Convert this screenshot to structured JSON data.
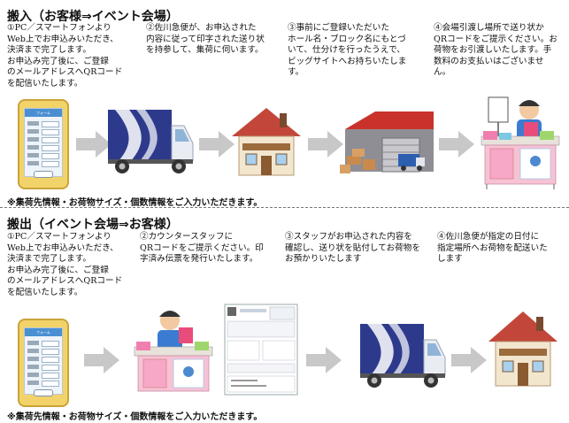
{
  "section_in": {
    "title": "搬入（お客様⇒イベント会場）",
    "steps": [
      "①PC／スマートフォンより\nWeb上でお申込みいただき、\n決済まで完了します。\nお申込み完了後に、ご登録\nのメールアドレスへQRコード\nを配信いたします。",
      "②佐川急便が、お申込された\n内容に従って印字された送り状\nを持参して、集荷に伺います。",
      "③事前にご登録いただいた\nホール名・ブロック名にもとづ\nいて、仕分けを行ったうえで、\nビッグサイトへお持ちいたしま\nす。",
      "④会場引渡し場所で送り状か\nQRコードをご提示ください。お\n荷物をお引渡しいたします。手\n数料のお支払いはございませ\nん。"
    ],
    "note": "※集荷先情報・お荷物サイズ・個数情報をご入力いただきます。"
  },
  "section_out": {
    "title": "搬出（イベント会場⇒お客様）",
    "steps": [
      "①PC／スマートフォンより\nWeb上でお申込みいただき、\n決済まで完了します。\nお申込み完了後に、ご登録\nのメールアドレスへQRコード\nを配信いたします。",
      "②カウンタースタッフに\nQRコードをご提示ください。印\n字済み伝票を発行いたします。",
      "③スタッフがお申込された内容を\n確認し、送り状を貼付してお荷物を\nお預かりいたします",
      "④佐川急便が指定の日付に\n指定場所へお荷物を配送いた\nします"
    ],
    "note": "※集荷先情報・お荷物サイズ・個数情報をご入力いただきます。"
  },
  "colors": {
    "arrow": "#c8c8c8",
    "truck_body": "#2d3a8c",
    "truck_cab": "#e9edf3",
    "house_roof": "#c2473a",
    "house_wall": "#f3e6cf",
    "warehouse_roof": "#c9322b",
    "phone_frame": "#f1d36a",
    "booth_table": "#f6c2d4"
  },
  "icons": {
    "phone": "smartphone-form-icon",
    "truck": "delivery-truck-icon",
    "house": "house-icon",
    "warehouse": "warehouse-icon",
    "booth": "event-booth-staff-icon",
    "slip": "shipping-slip-icon",
    "arrow": "right-arrow-icon"
  }
}
